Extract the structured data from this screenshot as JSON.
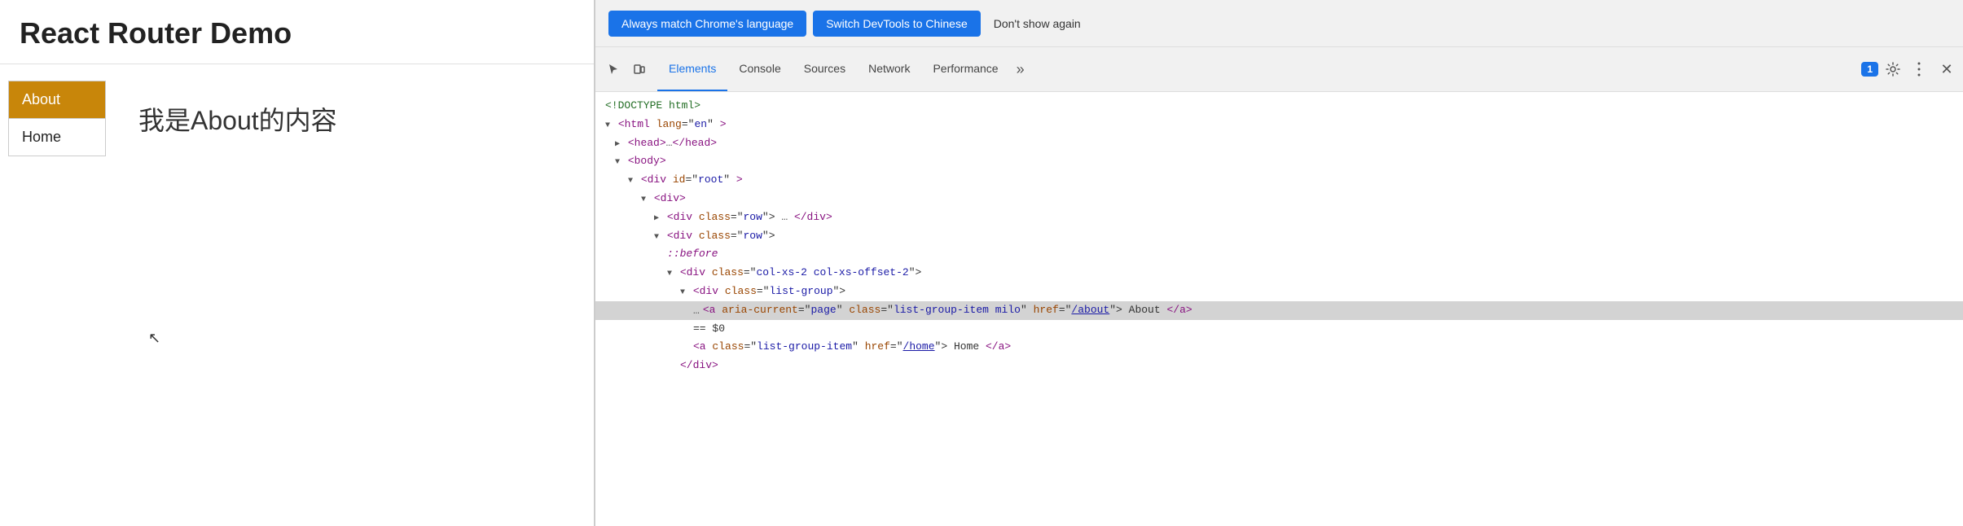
{
  "app": {
    "title": "React Router Demo",
    "nav": {
      "about_label": "About",
      "home_label": "Home"
    },
    "content": {
      "about_text": "我是About的内容"
    }
  },
  "devtools": {
    "top_bar": {
      "btn_match_label": "Always match Chrome's language",
      "btn_switch_label": "Switch DevTools to Chinese",
      "btn_dont_show_label": "Don't show again"
    },
    "tabs": {
      "elements_label": "Elements",
      "console_label": "Console",
      "sources_label": "Sources",
      "network_label": "Network",
      "performance_label": "Performance",
      "more_label": "»",
      "badge_count": "1"
    },
    "dom": {
      "lines": [
        {
          "indent": 0,
          "content_type": "comment",
          "text": "<!DOCTYPE html>"
        },
        {
          "indent": 0,
          "content_type": "tag",
          "text": "<html lang=\"en\">"
        },
        {
          "indent": 1,
          "content_type": "tag-collapsed",
          "text": "<head>…</head>"
        },
        {
          "indent": 1,
          "content_type": "tag",
          "text": "<body>"
        },
        {
          "indent": 2,
          "content_type": "tag",
          "text": "<div id=\"root\">"
        },
        {
          "indent": 3,
          "content_type": "tag",
          "text": "<div>"
        },
        {
          "indent": 4,
          "content_type": "tag-collapsed",
          "text": "<div class=\"row\">…</div>"
        },
        {
          "indent": 4,
          "content_type": "tag",
          "text": "<div class=\"row\">"
        },
        {
          "indent": 5,
          "content_type": "pseudo",
          "text": "::before"
        },
        {
          "indent": 5,
          "content_type": "tag",
          "text": "<div class=\"col-xs-2 col-xs-offset-2\">"
        },
        {
          "indent": 6,
          "content_type": "tag",
          "text": "<div class=\"list-group\">"
        },
        {
          "indent": 7,
          "content_type": "highlighted",
          "text": "<a aria-current=\"page\" class=\"list-group-item milo\" href=\"/about\">About</a>"
        },
        {
          "indent": 7,
          "content_type": "dollar",
          "text": "== $0"
        },
        {
          "indent": 7,
          "content_type": "tag-plain",
          "text": "<a class=\"list-group-item\" href=\"/home\">Home</a>"
        },
        {
          "indent": 6,
          "content_type": "close",
          "text": "</div>"
        }
      ]
    }
  }
}
